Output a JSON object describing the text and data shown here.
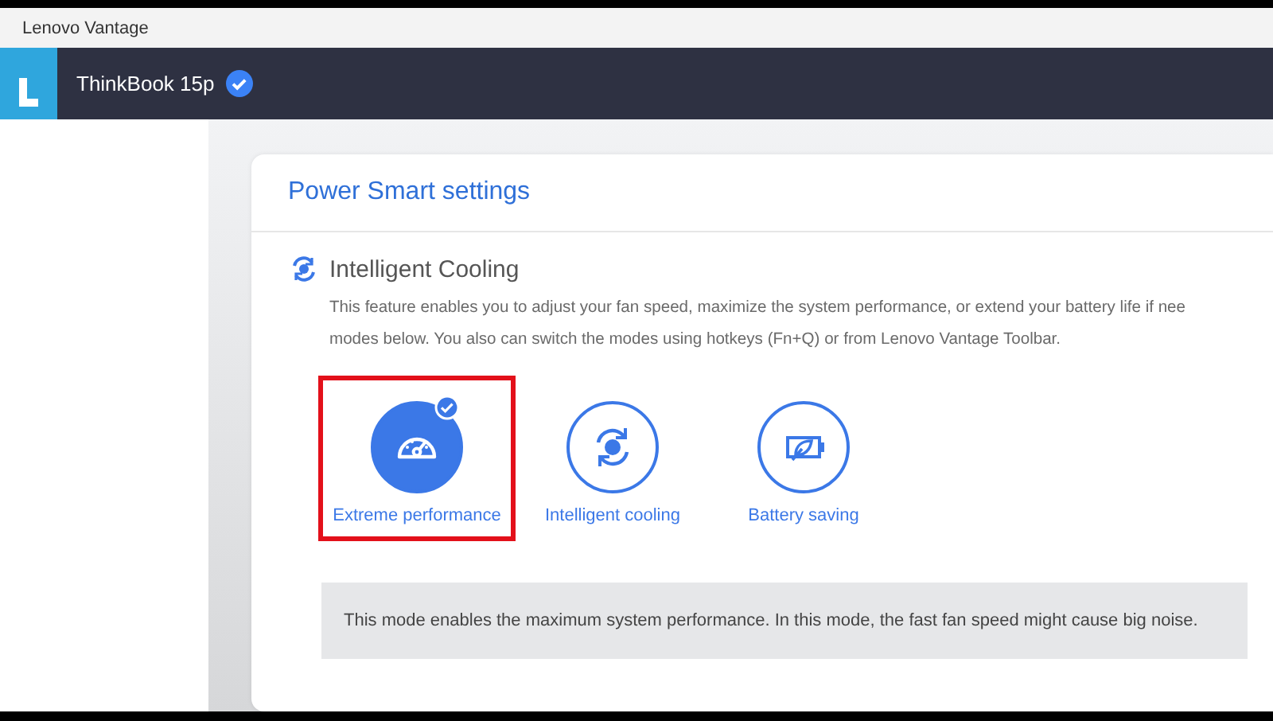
{
  "window": {
    "title": "Lenovo Vantage"
  },
  "header": {
    "device_name": "ThinkBook 15p",
    "verified": true
  },
  "card": {
    "title": "Power Smart settings",
    "section": {
      "title": "Intelligent Cooling",
      "description": "This feature enables you to adjust your fan speed, maximize the system performance, or extend your battery life if nee\nmodes below. You also can switch the modes using hotkeys (Fn+Q) or from Lenovo Vantage Toolbar.",
      "modes": [
        {
          "kind": "performance",
          "label": "Extreme performance",
          "selected": true,
          "annotated": true
        },
        {
          "kind": "cooling",
          "label": "Intelligent cooling",
          "selected": false,
          "annotated": false
        },
        {
          "kind": "battery",
          "label": "Battery saving",
          "selected": false,
          "annotated": false
        }
      ],
      "mode_info": "This mode enables the maximum system performance. In this mode, the fast fan speed might cause big noise."
    }
  }
}
